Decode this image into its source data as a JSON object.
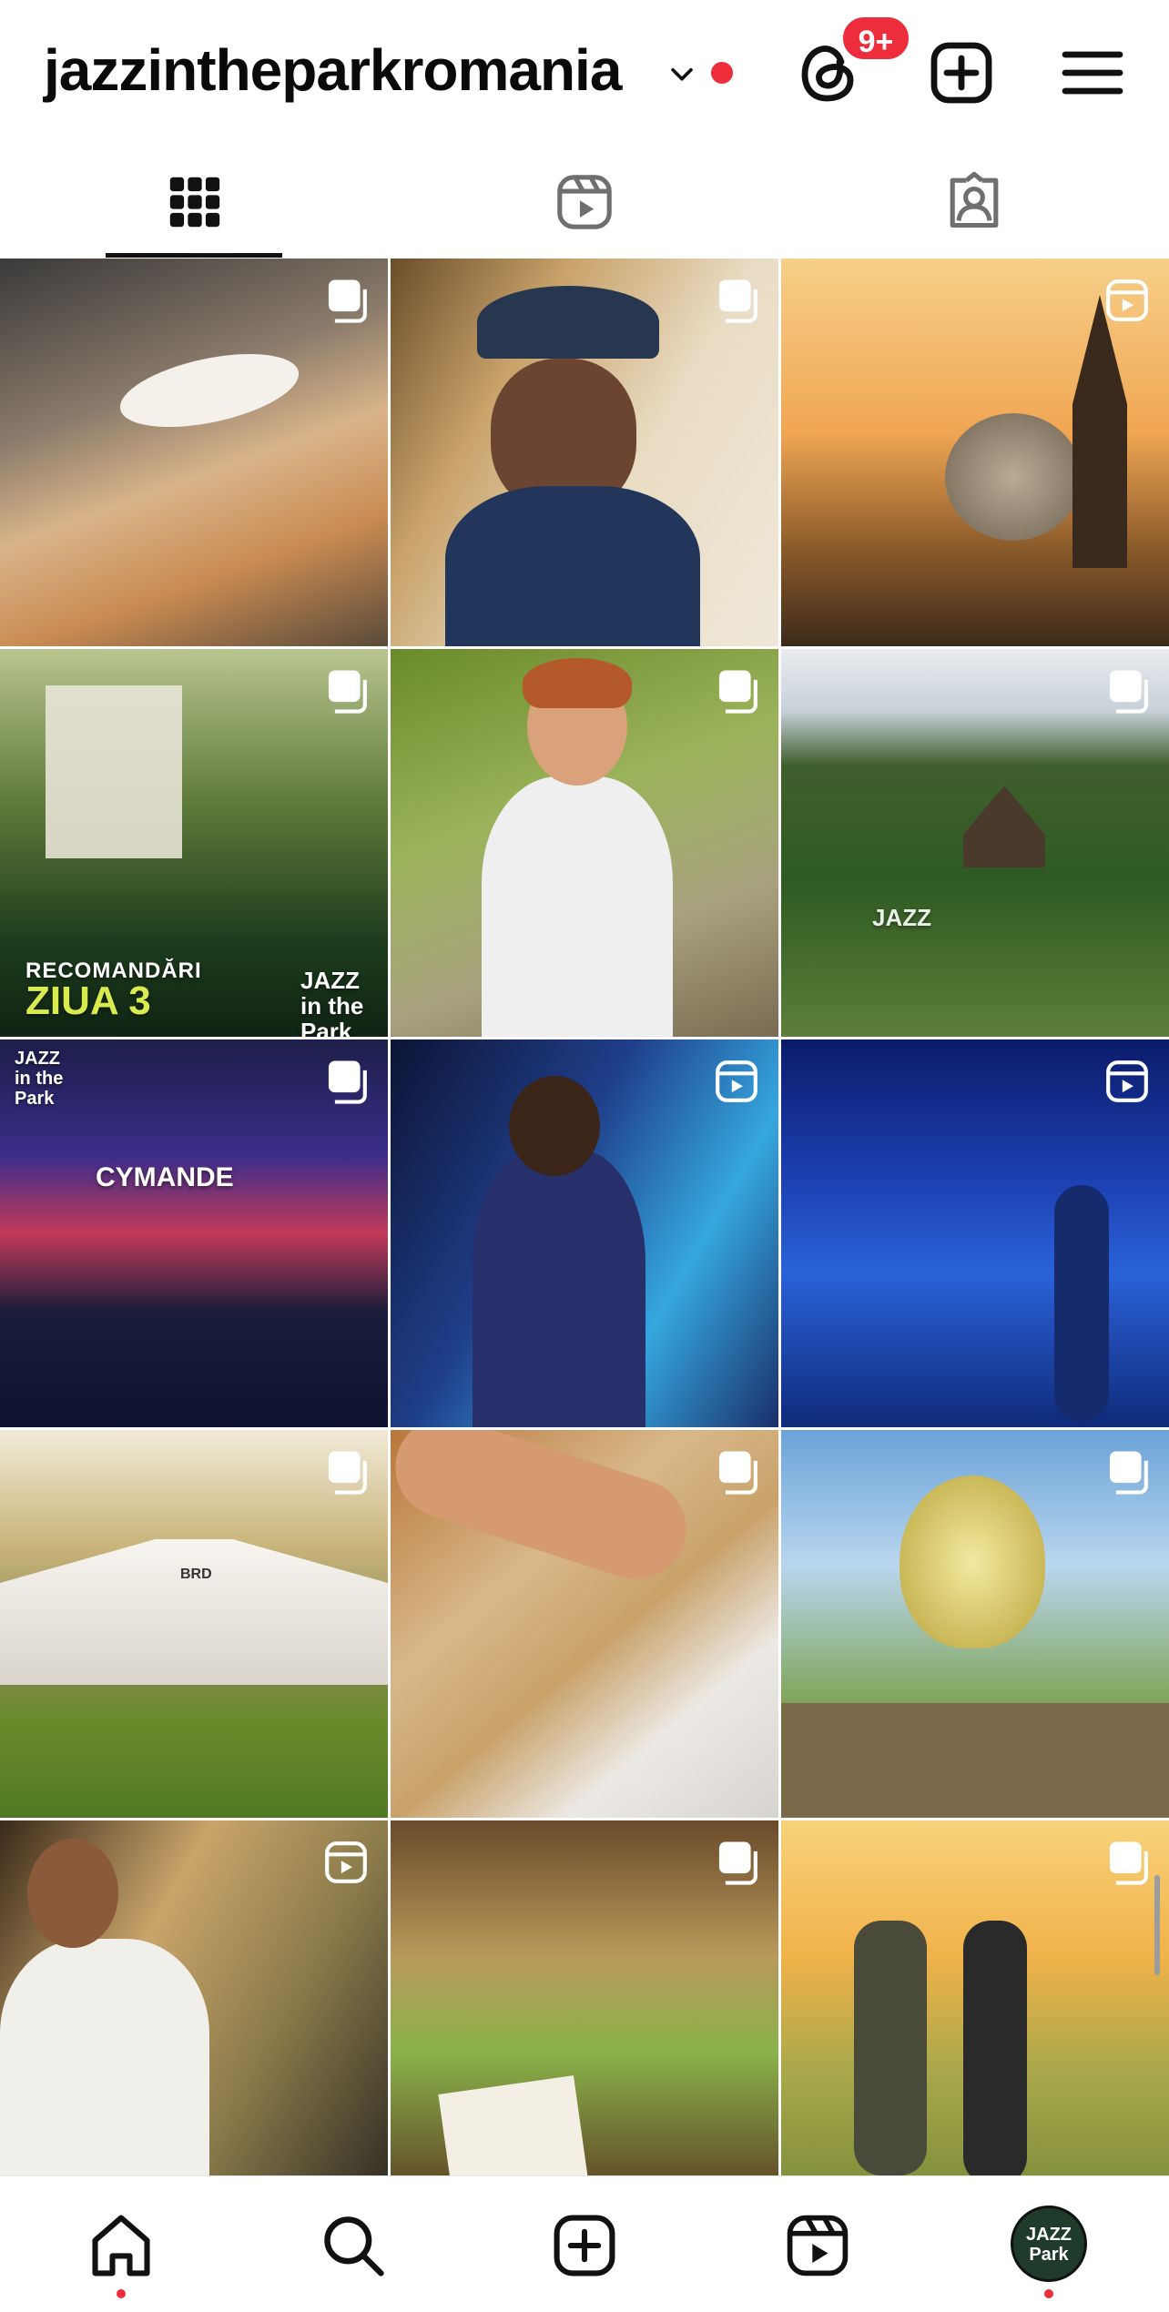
{
  "header": {
    "username": "jazzintheparkromania",
    "notification_badge": "9+",
    "icons": [
      "chevron-down-icon",
      "threads-icon",
      "plus-square-icon",
      "hamburger-menu-icon"
    ]
  },
  "tabs": [
    {
      "name": "grid",
      "icon": "grid-icon",
      "active": true
    },
    {
      "name": "reels",
      "icon": "reels-icon",
      "active": false
    },
    {
      "name": "tagged",
      "icon": "tagged-icon",
      "active": false
    }
  ],
  "posts": [
    {
      "type": "carousel",
      "caption": ""
    },
    {
      "type": "carousel",
      "caption": ""
    },
    {
      "type": "reel",
      "caption": ""
    },
    {
      "type": "carousel",
      "caption_line1": "RECOMANDĂRI",
      "caption_line2": "ZIUA 3",
      "brand": "JAZZ in the Park"
    },
    {
      "type": "carousel",
      "caption": ""
    },
    {
      "type": "carousel",
      "caption": "JAZZ"
    },
    {
      "type": "carousel",
      "caption": "CYMANDE",
      "brand": "JAZZ in the Park"
    },
    {
      "type": "reel",
      "caption": ""
    },
    {
      "type": "reel",
      "caption": ""
    },
    {
      "type": "carousel",
      "caption": "BRD"
    },
    {
      "type": "carousel",
      "caption": ""
    },
    {
      "type": "carousel",
      "caption": ""
    },
    {
      "type": "reel",
      "caption": ""
    },
    {
      "type": "carousel",
      "caption": ""
    },
    {
      "type": "carousel",
      "caption": ""
    }
  ],
  "bottom_nav": {
    "items": [
      "home-icon",
      "search-icon",
      "create-icon",
      "reels-icon",
      "profile-avatar"
    ],
    "avatar_text_line1": "JAZZ",
    "avatar_text_line2": "Park"
  },
  "colors": {
    "badge": "#ee2d3c",
    "text": "#0a0a0a"
  }
}
